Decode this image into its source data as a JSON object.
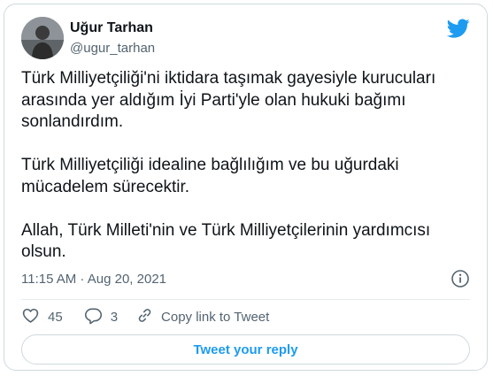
{
  "author": {
    "name": "Uğur Tarhan",
    "handle": "@ugur_tarhan"
  },
  "tweet": {
    "text": "Türk Milliyetçiliği'ni iktidara taşımak gayesiyle kurucuları arasında yer aldığım İyi Parti'yle olan hukuki bağımı sonlandırdım.\n\nTürk Milliyetçiliği idealine bağlılığım ve bu uğurdaki mücadelem sürecektir.\n\nAllah, Türk Milleti'nin ve Türk Milliyetçilerinin yardımcısı olsun.",
    "timestamp": "11:15 AM · Aug 20, 2021"
  },
  "actions": {
    "likes": "45",
    "replies": "3",
    "copy_link_label": "Copy link to Tweet"
  },
  "reply_button_label": "Tweet your reply",
  "icons": {
    "brand": "twitter-bird-icon",
    "info": "info-icon",
    "like": "heart-icon",
    "reply": "reply-bubble-icon",
    "copy": "link-icon"
  },
  "colors": {
    "accent": "#1d9bf0",
    "text": "#0f1419",
    "secondary": "#536471",
    "border": "#cfd9de"
  }
}
